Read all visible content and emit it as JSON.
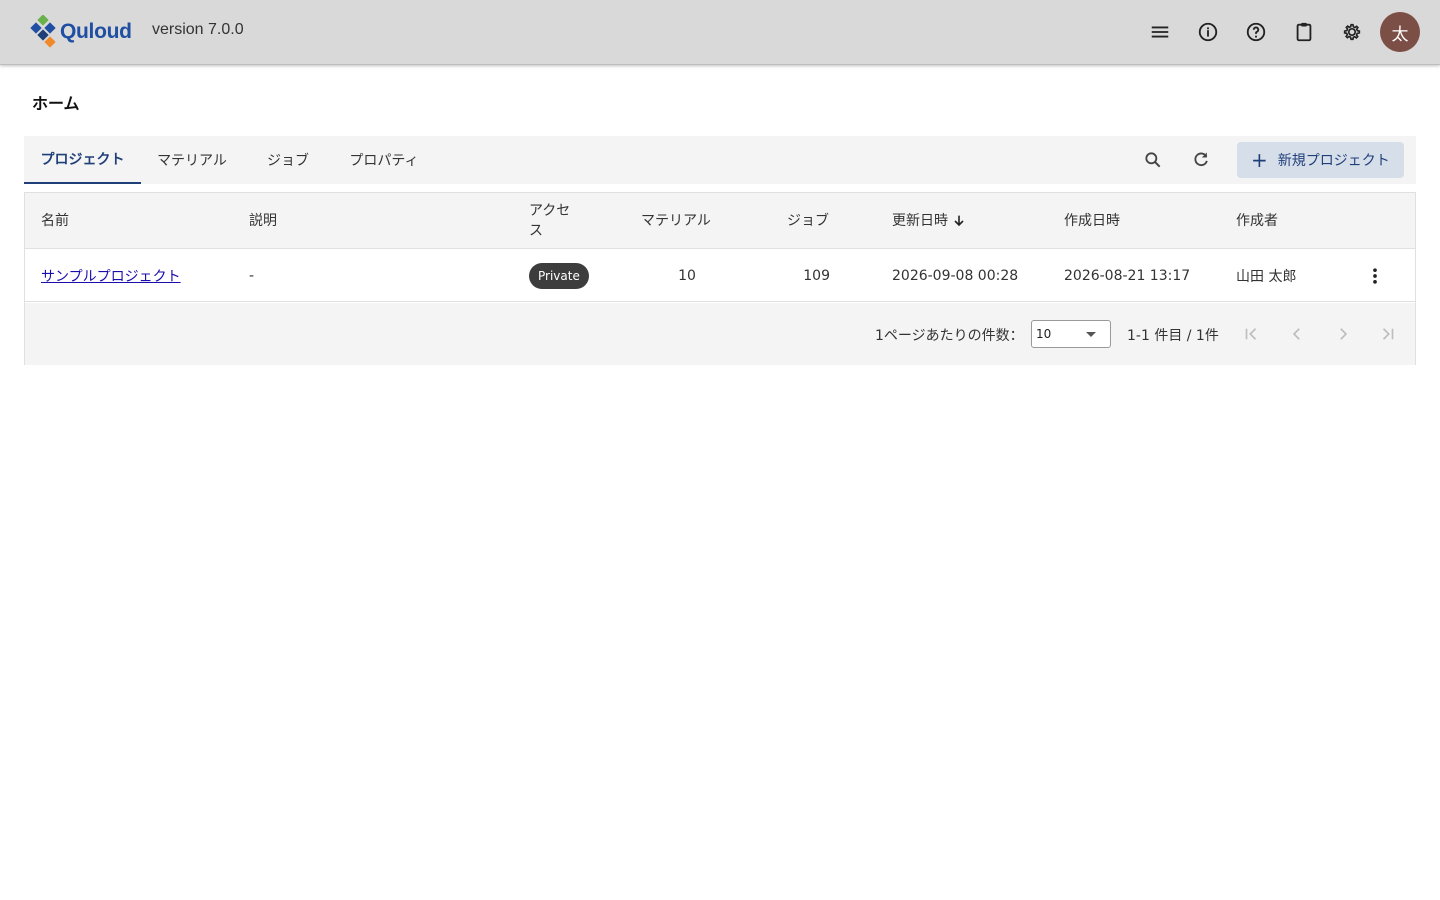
{
  "header": {
    "logo_text": "Quloud",
    "version": "version 7.0.0",
    "avatar_initial": "太"
  },
  "page": {
    "title": "ホーム"
  },
  "tabs": [
    {
      "label": "プロジェクト",
      "active": true
    },
    {
      "label": "マテリアル",
      "active": false
    },
    {
      "label": "ジョブ",
      "active": false
    },
    {
      "label": "プロパティ",
      "active": false
    }
  ],
  "toolbar": {
    "new_project_label": "新規プロジェクト"
  },
  "table": {
    "headers": {
      "name": "名前",
      "description": "説明",
      "access_line1": "アクセ",
      "access_line2": "ス",
      "materials": "マテリアル",
      "jobs": "ジョブ",
      "updated": "更新日時",
      "created": "作成日時",
      "creator": "作成者"
    },
    "rows": [
      {
        "name": "サンプルプロジェクト",
        "description": "-",
        "access": "Private",
        "materials": "10",
        "jobs": "109",
        "updated": "2026-09-08 00:28",
        "created": "2026-08-21 13:17",
        "creator": "山田 太郎"
      }
    ]
  },
  "pagination": {
    "per_page_label": "1ページあたりの件数：",
    "per_page_value": "10",
    "range": "1-1 件目 / 1件"
  },
  "colors": {
    "accent": "#1f3f78",
    "header_bg": "#d9d9d9",
    "avatar_bg": "#7b4f45",
    "logo_blue": "#1f4ea3"
  }
}
